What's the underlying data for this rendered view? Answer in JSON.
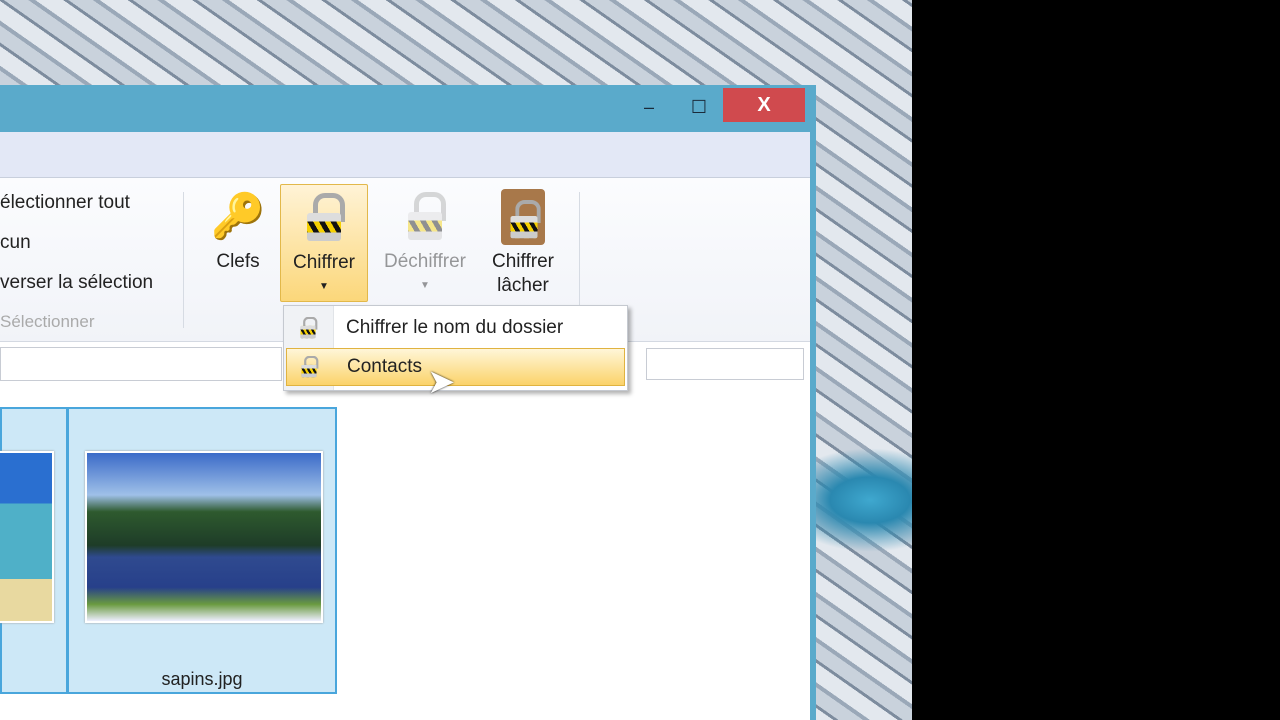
{
  "window": {
    "minimize": "–",
    "maximize": "☐",
    "close": "X"
  },
  "ribbon": {
    "select_all": "électionner tout",
    "select_none": "cun",
    "invert": "verser la sélection",
    "group_label": "Sélectionner",
    "keys": "Clefs",
    "encrypt": "Chiffrer",
    "decrypt": "Déchiffrer",
    "encrypt_drop_1": "Chiffrer",
    "encrypt_drop_2": "lâcher"
  },
  "menu": {
    "items": [
      {
        "label": "Chiffrer le nom du dossier"
      },
      {
        "label": "Contacts"
      }
    ]
  },
  "files": [
    {
      "name": ""
    },
    {
      "name": "sapins.jpg"
    }
  ]
}
